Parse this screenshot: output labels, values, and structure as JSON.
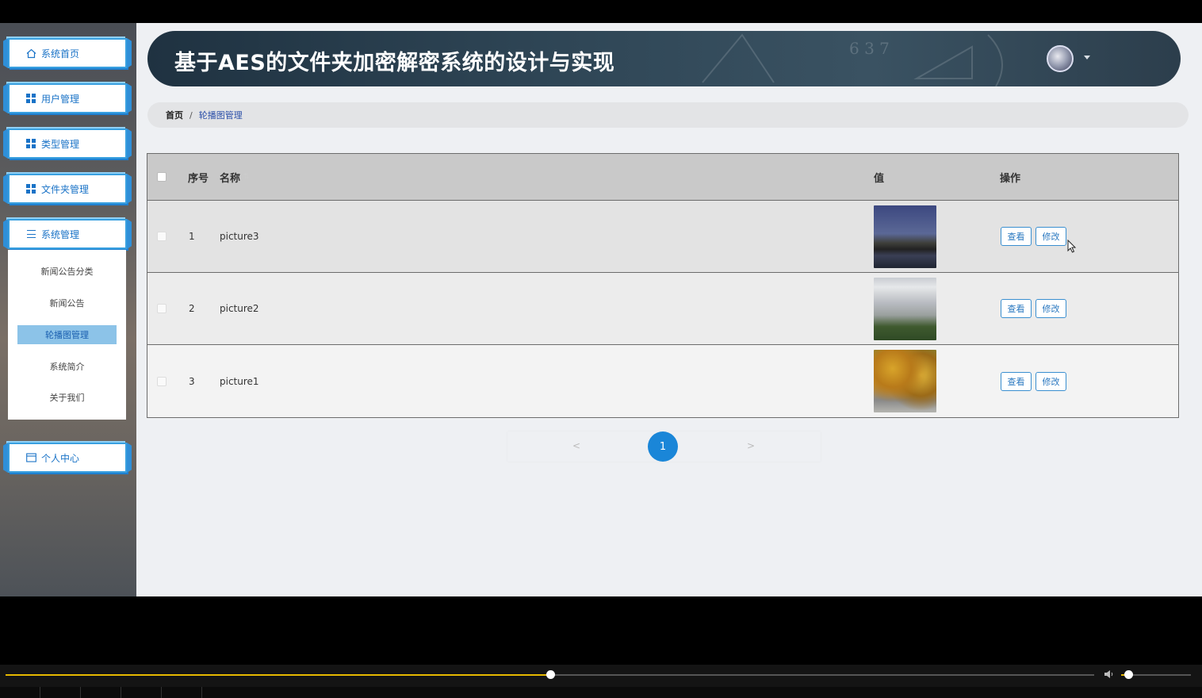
{
  "header": {
    "title": "基于AES的文件夹加密解密系统的设计与实现",
    "deco_digits": "6 3 7"
  },
  "sidebar": {
    "menus": [
      {
        "label": "系统首页",
        "icon": "home-icon"
      },
      {
        "label": "用户管理",
        "icon": "grid-icon"
      },
      {
        "label": "类型管理",
        "icon": "grid-icon"
      },
      {
        "label": "文件夹管理",
        "icon": "grid-icon"
      },
      {
        "label": "系统管理",
        "icon": "menu-lines-icon"
      }
    ],
    "submenu": [
      {
        "label": "新闻公告分类"
      },
      {
        "label": "新闻公告"
      },
      {
        "label": "轮播图管理",
        "active": true
      },
      {
        "label": "系统简介"
      },
      {
        "label": "关于我们"
      }
    ],
    "personal": {
      "label": "个人中心",
      "icon": "card-icon"
    }
  },
  "breadcrumb": {
    "home": "首页",
    "separator": "/",
    "current": "轮播图管理"
  },
  "table": {
    "columns": {
      "index": "序号",
      "name": "名称",
      "value": "值",
      "actions": "操作"
    },
    "rows": [
      {
        "index": "1",
        "name": "picture3",
        "image": "campus-night-building"
      },
      {
        "index": "2",
        "name": "picture2",
        "image": "white-building-trees"
      },
      {
        "index": "3",
        "name": "picture1",
        "image": "autumn-trees-road"
      }
    ],
    "view_label": "查看",
    "edit_label": "修改"
  },
  "pagination": {
    "prev": "<",
    "current": "1",
    "next": ">"
  },
  "player": {
    "progress": 0.5,
    "volume": 0.1
  },
  "colors": {
    "accent": "#1a86d8",
    "header_bg": "#2f4656",
    "sidebar_border": "#39a0e0"
  }
}
